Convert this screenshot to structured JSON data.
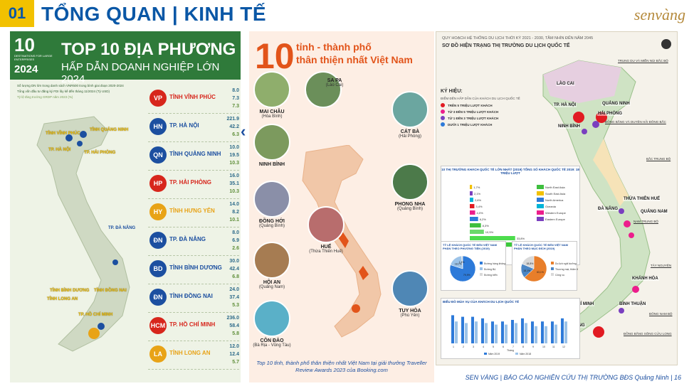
{
  "header": {
    "number": "01",
    "title": "TỔNG QUAN | KINH TẾ",
    "logo": "senvàng"
  },
  "left": {
    "badge_top": "10",
    "badge_sub": "DESTINATIONS FOR LARGE ENTERPRISES",
    "badge_year": "2024",
    "title1": "TOP 10 ĐỊA PHƯƠNG",
    "title2": "HẤP DẪN DOANH NGHIỆP LỚN 2024",
    "legend": [
      "Số lượng DN lớn trong danh sách VNR500 trong bình giai đoạn 2020-2024",
      "Tổng vốn đầu tư đăng ký FDI lũy kế đến tháng 11/2024 (Tỷ USD)",
      "Tỷ lệ tăng trưởng GRDP năm 2023 (%)"
    ],
    "watermark": "VIETNAM REPORT",
    "map_labels": [
      {
        "text": "TỈNH VĨNH PHÚC"
      },
      {
        "text": "TỈNH QUẢNG NINH"
      },
      {
        "text": "TP. HÀ NỘI"
      },
      {
        "text": "TP. HẢI PHÒNG"
      },
      {
        "text": "TP. ĐÀ NẴNG"
      },
      {
        "text": "TỈNH BÌNH DƯƠNG"
      },
      {
        "text": "TỈNH ĐỒNG NAI"
      },
      {
        "text": "TỈNH LONG AN"
      },
      {
        "text": "TP. HỒ CHÍ MINH"
      }
    ],
    "ranks": [
      {
        "name": "TỈNH VĨNH PHÚC",
        "v1": "8.0",
        "v2": "7.3",
        "v3": "7.3"
      },
      {
        "name": "TP. HÀ NỘI",
        "v1": "221.9",
        "v2": "42.2",
        "v3": "6.3"
      },
      {
        "name": "TỈNH QUẢNG NINH",
        "v1": "10.0",
        "v2": "19.5",
        "v3": "10.3"
      },
      {
        "name": "TP. HẢI PHÒNG",
        "v1": "16.0",
        "v2": "35.1",
        "v3": "10.3"
      },
      {
        "name": "TỈNH HƯNG YÊN",
        "v1": "14.0",
        "v2": "8.2",
        "v3": "10.1"
      },
      {
        "name": "TP. ĐÀ NẴNG",
        "v1": "8.0",
        "v2": "6.9",
        "v3": "2.6"
      },
      {
        "name": "TỈNH BÌNH DƯƠNG",
        "v1": "30.0",
        "v2": "42.4",
        "v3": "6.8"
      },
      {
        "name": "TỈNH ĐỒNG NAI",
        "v1": "24.0",
        "v2": "37.4",
        "v3": "5.3"
      },
      {
        "name": "TP. HỒ CHÍ MINH",
        "v1": "236.0",
        "v2": "58.4",
        "v3": "5.8"
      },
      {
        "name": "TỈNH LONG AN",
        "v1": "12.0",
        "v2": "12.4",
        "v3": "5.7"
      }
    ]
  },
  "middle": {
    "big": "10",
    "title1": "tỉnh - thành phố",
    "title2": "thân thiện nhất Việt Nam",
    "places": [
      {
        "name": "SA PA",
        "prov": "(Lào Cai)"
      },
      {
        "name": "MAI CHÂU",
        "prov": "(Hòa Bình)"
      },
      {
        "name": "CÁT BÀ",
        "prov": "(Hải Phòng)"
      },
      {
        "name": "NINH BÌNH",
        "prov": ""
      },
      {
        "name": "PHONG NHA",
        "prov": "(Quảng Bình)"
      },
      {
        "name": "ĐỒNG HỚI",
        "prov": "(Quảng Bình)"
      },
      {
        "name": "HUẾ",
        "prov": "(Thừa Thiên Huế)"
      },
      {
        "name": "HỘI AN",
        "prov": "(Quảng Nam)"
      },
      {
        "name": "TUY HÒA",
        "prov": "(Phú Yên)"
      },
      {
        "name": "CÔN ĐẢO",
        "prov": "(Bà Rịa - Vũng Tàu)"
      }
    ],
    "caption": "Top 10 tỉnh, thành phố thân thiện nhất Việt Nam tại giải thưởng Traveller Review Awards 2023 của Booking.com"
  },
  "right": {
    "title1": "QUY HOẠCH HỆ THỐNG DU LỊCH THỜI KỲ 2021 - 2030, TẦM NHÌN ĐẾN NĂM 2045",
    "title2": "SƠ ĐỒ HIỆN TRẠNG THỊ TRƯỜNG DU LỊCH QUỐC TẾ",
    "key_title": "KÝ HIỆU:",
    "key_sub": "ĐIỂM ĐẾN HẤP DẪN CỦA KHÁCH DU LỊCH QUỐC TẾ",
    "key_items": [
      {
        "label": "TRÊN 5 TRIỆU LƯỢT KHÁCH",
        "color": "#e11b22"
      },
      {
        "label": "TỪ 3 ĐẾN 5 TRIỆU LƯỢT KHÁCH",
        "color": "#ec1e8c"
      },
      {
        "label": "TỪ 1 ĐẾN 3 TRIỆU LƯỢT KHÁCH",
        "color": "#7a3fbf"
      },
      {
        "label": "DƯỚI 1 TRIỆU LƯỢT KHÁCH",
        "color": "#2d7ad9"
      }
    ],
    "places": [
      {
        "text": "LÀO CAI"
      },
      {
        "text": "TP. HÀ NỘI"
      },
      {
        "text": "QUẢNG NINH"
      },
      {
        "text": "HẢI PHÒNG"
      },
      {
        "text": "NINH BÌNH"
      },
      {
        "text": "THỪA THIÊN HUẾ"
      },
      {
        "text": "ĐÀ NẴNG"
      },
      {
        "text": "QUẢNG NAM"
      },
      {
        "text": "KHÁNH HÒA"
      },
      {
        "text": "BÌNH THUẬN"
      },
      {
        "text": "TP. HỒ CHÍ MINH"
      },
      {
        "text": "KIÊN GIANG"
      }
    ],
    "regions": [
      {
        "text": "TRUNG DU VÀ MIỀN NÚI BẮC BỘ"
      },
      {
        "text": "ĐỒNG BẰNG VÀ DUYÊN HẢI ĐÔNG BẮC"
      },
      {
        "text": "BẮC TRUNG BỘ"
      },
      {
        "text": "NAM TRUNG BỘ"
      },
      {
        "text": "TÂY NGUYÊN"
      },
      {
        "text": "ĐÔNG NAM BỘ"
      },
      {
        "text": "ĐỒNG BẰNG SÔNG CỬU LONG"
      }
    ],
    "bar_title": "10 THỊ TRƯỜNG KHÁCH QUỐC TẾ LỚN NHẤT (2019) TỔNG SỐ KHÁCH QUỐC TẾ 2019: 18 TRIỆU LƯỢT",
    "pie1_title": "TỶ LỆ KHÁCH QUỐC TẾ ĐẾN VIỆT NAM PHÂN THEO PHƯƠNG TIỆN (2019)",
    "pie2_title": "TỶ LỆ KHÁCH QUỐC TẾ ĐẾN VIỆT NAM PHÂN THEO MỤC ĐÍCH (2019)",
    "season_title": "BIỂU ĐỒ MÙA VỤ CỦA KHÁCH DU LỊCH QUỐC TẾ"
  },
  "footer": "SEN VÀNG | BÁO CÁO NGHIÊN CỨU THỊ TRƯỜNG BĐS Quảng Ninh | 16",
  "chart_data": [
    {
      "type": "bar",
      "title": "10 THỊ TRƯỜNG KHÁCH QUỐC TẾ LỚN NHẤT (2019)",
      "series": [
        {
          "values": [
            1.7,
            2.1,
            2.6,
            3.4,
            4.0,
            6.2,
            8.3,
            10.5,
            33.8,
            32.2
          ]
        }
      ],
      "bar_colors": [
        "#f2c100",
        "#7a3fbf",
        "#00b4d8",
        "#e11b22",
        "#ec1e8c",
        "#2d7ad9",
        "#3fbf3f",
        "#6bd96b",
        "#4ddc4d",
        "#3cc93c"
      ],
      "legend": [
        "North East Asia",
        "South East Asia",
        "North America",
        "Oceania",
        "Western Europe",
        "Eastern Europe"
      ],
      "legend_colors": [
        "#3fbf3f",
        "#f2c100",
        "#2d7ad9",
        "#00b4d8",
        "#ec1e8c",
        "#7a3fbf"
      ]
    },
    {
      "type": "pie",
      "title": "PHÂN THEO PHƯƠNG TIỆN (2019)",
      "values": [
        79.9,
        18.7,
        1.4
      ],
      "colors": [
        "#2d7ad9",
        "#9cc3e8",
        "#d9d9d9"
      ],
      "labels": [
        "79,9%",
        "18,7%",
        "1,4%"
      ],
      "legend": [
        "Đường hàng không",
        "Đường Bộ",
        "Đường biển"
      ]
    },
    {
      "type": "pie",
      "title": "PHÂN THEO MỤC ĐÍCH (2019)",
      "values": [
        63.1,
        18.1,
        18.8
      ],
      "colors": [
        "#e87e2a",
        "#4b86c5",
        "#d9d9d9"
      ],
      "labels": [
        "63,1%",
        "18,1%",
        "18,8%"
      ],
      "legend": [
        "Du lịch nghỉ dưỡng",
        "Thương mại, thăm thân",
        "Công vụ"
      ]
    },
    {
      "type": "bar",
      "title": "BIỂU ĐỒ MÙA VỤ CỦA KHÁCH DU LỊCH QUỐC TẾ",
      "categories": [
        "1",
        "2",
        "3",
        "4",
        "5",
        "6",
        "7",
        "8",
        "9",
        "10",
        "11",
        "12"
      ],
      "series": [
        {
          "name": "Năm 2019",
          "values": [
            1.8,
            1.7,
            1.7,
            1.6,
            1.4,
            1.4,
            1.5,
            1.6,
            1.4,
            1.4,
            1.4,
            1.6
          ]
        },
        {
          "name": "Năm 2018",
          "values": [
            1.4,
            1.3,
            1.4,
            1.3,
            1.2,
            1.2,
            1.3,
            1.3,
            1.1,
            1.1,
            1.2,
            1.4
          ]
        }
      ],
      "series_colors": [
        "#2d7ad9",
        "#9cc3e8"
      ],
      "ylim": [
        0,
        2.0
      ],
      "xlabel": "Tháng"
    }
  ]
}
